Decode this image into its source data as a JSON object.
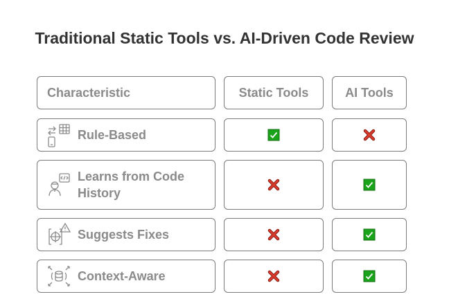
{
  "title": "Traditional Static Tools vs. AI-Driven Code Review",
  "headers": {
    "characteristic": "Characteristic",
    "static": "Static Tools",
    "ai": "AI Tools"
  },
  "rows": [
    {
      "label": "Rule-Based",
      "icon": "rule-based-icon",
      "static": "check",
      "ai": "cross"
    },
    {
      "label": "Learns from Code History",
      "icon": "learning-icon",
      "static": "cross",
      "ai": "check"
    },
    {
      "label": "Suggests Fixes",
      "icon": "suggest-fix-icon",
      "static": "cross",
      "ai": "check"
    },
    {
      "label": "Context-Aware",
      "icon": "context-aware-icon",
      "static": "cross",
      "ai": "check"
    }
  ],
  "colors": {
    "check": "#1aa31a",
    "cross": "#d93a2b",
    "border": "#7a7a7a",
    "text": "#8a8a8a",
    "title": "#333333"
  }
}
